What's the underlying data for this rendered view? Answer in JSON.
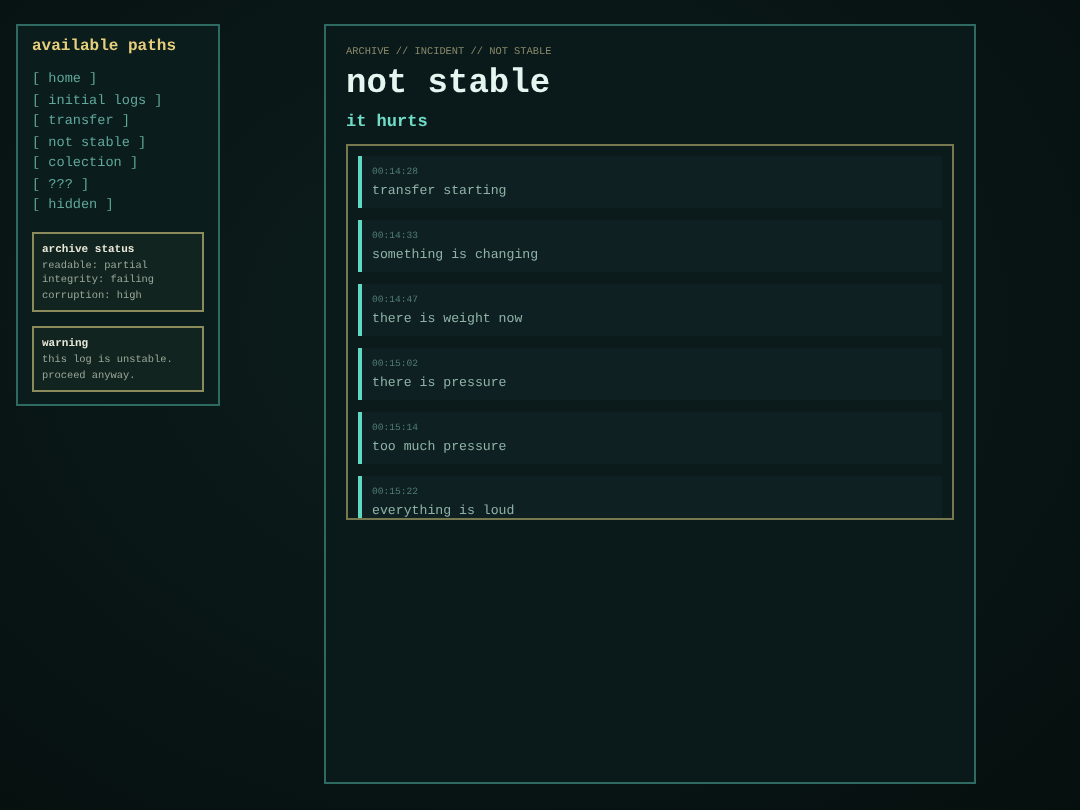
{
  "sidebar": {
    "title": "available paths",
    "links": [
      "[ home ]",
      "[ initial logs ]",
      "[ transfer ]",
      "[ not stable ]",
      "[ colection ]",
      "[ ??? ]",
      "[ hidden ]"
    ],
    "cards": [
      {
        "title": "archive status",
        "lines": [
          "readable: partial",
          "integrity: failing",
          "corruption: high"
        ]
      },
      {
        "title": "warning",
        "lines": [
          "this log is unstable.",
          "proceed anyway."
        ]
      }
    ]
  },
  "main": {
    "breadcrumb": "ARCHIVE // INCIDENT // NOT STABLE",
    "title": "not stable",
    "subtitle": "it hurts",
    "log": [
      {
        "time": "00:14:28",
        "text": "transfer starting"
      },
      {
        "time": "00:14:33",
        "text": "something is changing"
      },
      {
        "time": "00:14:47",
        "text": "there is weight now"
      },
      {
        "time": "00:15:02",
        "text": "there is pressure"
      },
      {
        "time": "00:15:14",
        "text": "too much pressure"
      },
      {
        "time": "00:15:22",
        "text": "everything is loud"
      }
    ]
  }
}
